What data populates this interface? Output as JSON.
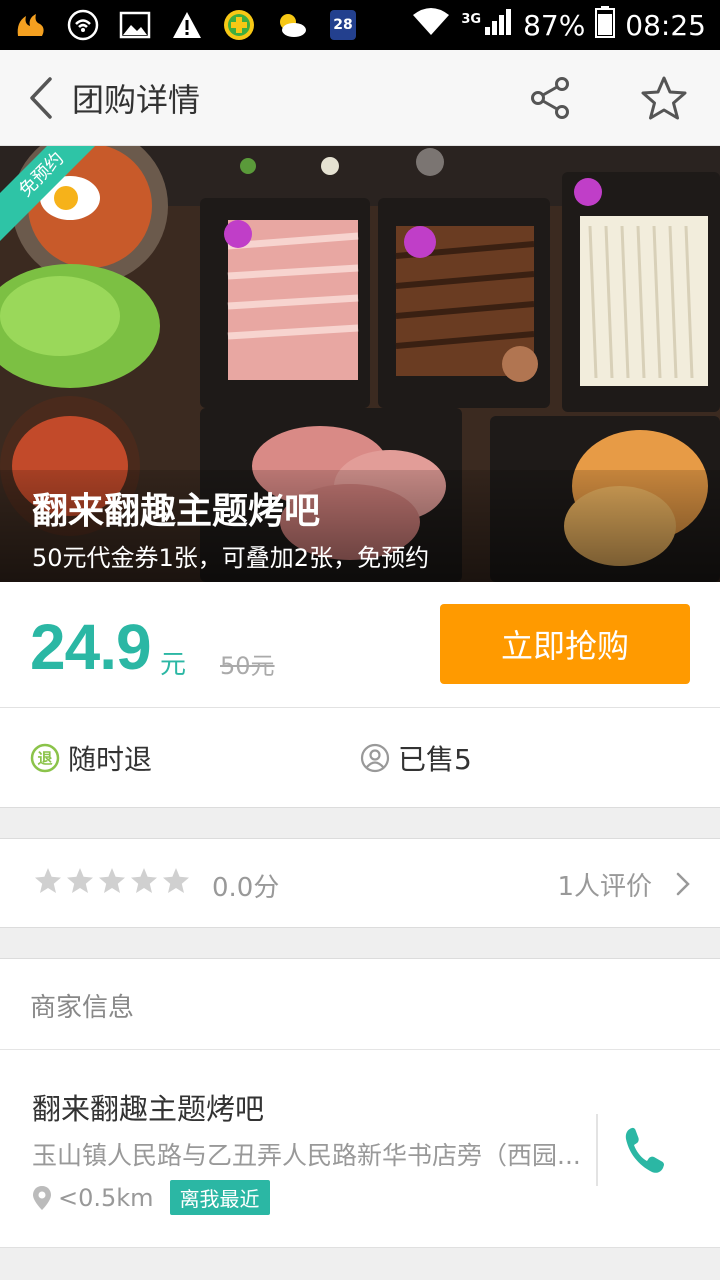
{
  "status_bar": {
    "battery": "87%",
    "time": "08:25",
    "network": "3G",
    "badge_number": "28",
    "icons": [
      "uc-browser-icon",
      "wifi-hotspot-icon",
      "image-icon",
      "warning-icon",
      "cross-plus-icon",
      "weather-icon",
      "calendar-icon",
      "wifi-icon",
      "signal-icon",
      "battery-icon"
    ]
  },
  "header": {
    "title": "团购详情",
    "icons": [
      "back-chevron-icon",
      "share-icon",
      "star-icon"
    ]
  },
  "hero": {
    "ribbon": "免预约",
    "title": "翻来翻趣主题烤吧",
    "subtitle": "50元代金券1张，可叠加2张，免预约"
  },
  "price": {
    "current": "24.9",
    "unit": "元",
    "original": "50元",
    "buy_label": "立即抢购",
    "accent": "#2bb7a4",
    "button_color": "#ff9a00"
  },
  "features": {
    "refund": "随时退",
    "sold": "已售5"
  },
  "rating": {
    "stars_filled": 0,
    "stars_total": 5,
    "score": "0.0分",
    "reviews": "1人评价"
  },
  "merchant": {
    "section_title": "商家信息",
    "name": "翻来翻趣主题烤吧",
    "address": "玉山镇人民路与乙丑弄人民路新华书店旁（西园...",
    "distance": "<0.5km",
    "badge": "离我最近"
  }
}
